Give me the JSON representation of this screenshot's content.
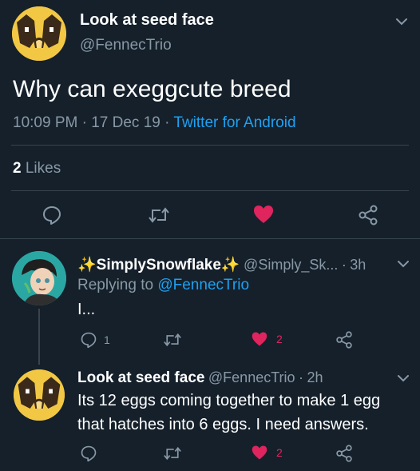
{
  "main_tweet": {
    "display_name": "Look at seed face",
    "handle": "@FennecTrio",
    "text": "Why can exeggcute breed",
    "time": "10:09 PM",
    "date": "17 Dec 19",
    "source": "Twitter for Android",
    "likes_count": "2",
    "likes_label": "Likes",
    "liked": true
  },
  "reply1": {
    "display_name": "✨SimplySnowflake✨",
    "handle": "@Simply_Sk...",
    "age": "3h",
    "replying_to_label": "Replying to",
    "replying_to_handle": "@FennecTrio",
    "text": "I...",
    "reply_count": "1",
    "like_count": "2"
  },
  "reply2": {
    "display_name": "Look at seed face",
    "handle": "@FennecTrio",
    "age": "2h",
    "text_line1": "Its 12 eggs coming together to make 1 egg",
    "text_line2": "that hatches into 6 eggs. I need answers.",
    "like_count": "2"
  },
  "separator": "·",
  "colors": {
    "background": "#15202b",
    "accent": "#1da1f2",
    "like": "#e0245e",
    "muted": "#8899a6",
    "divider": "#38444d"
  },
  "icons": [
    "chevron-down-icon",
    "reply-icon",
    "retweet-icon",
    "heart-icon",
    "share-icon",
    "sparkle-icon"
  ]
}
